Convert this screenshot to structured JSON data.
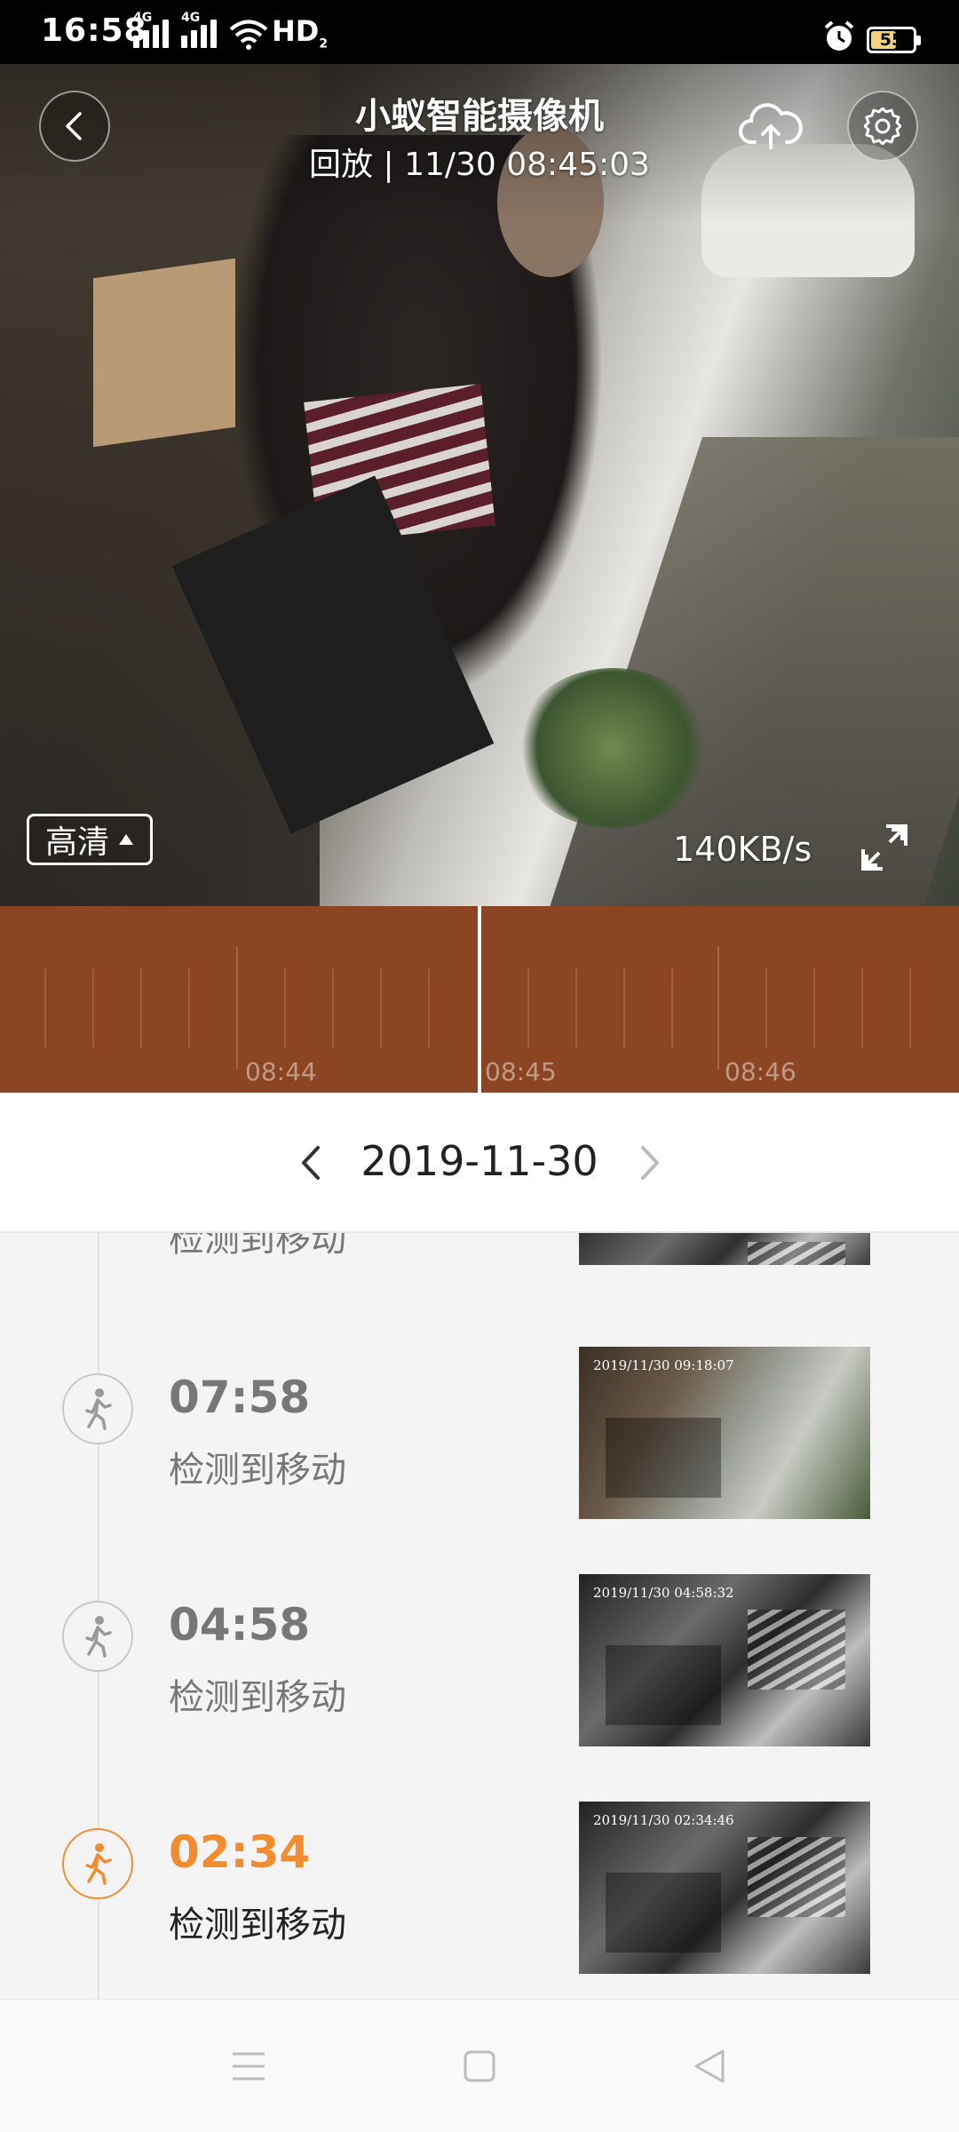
{
  "status_bar": {
    "time": "16:58",
    "signal1_tag": "4G",
    "signal2_tag": "4G",
    "hd_label": "HD",
    "hd_sub": "2",
    "battery": "55"
  },
  "header": {
    "title": "小蚁智能摄像机",
    "subtitle": "回放 | 11/30 08:45:03",
    "back_icon": "chevron-left-icon",
    "upload_icon": "cloud-upload-icon",
    "settings_icon": "gear-icon"
  },
  "player": {
    "quality_label": "高清",
    "bitrate": "140KB/s",
    "fullscreen_icon": "exit-fullscreen-icon"
  },
  "timeline": {
    "labels": [
      "08:44",
      "08:45",
      "08:46"
    ],
    "color": "#8b4523"
  },
  "date_nav": {
    "date": "2019-11-30"
  },
  "events": [
    {
      "time": "",
      "desc": "检测到移动",
      "stamp": ""
    },
    {
      "time": "07:58",
      "desc": "检测到移动",
      "stamp": "2019/11/30  09:18:07"
    },
    {
      "time": "04:58",
      "desc": "检测到移动",
      "stamp": "2019/11/30  04:58:32"
    },
    {
      "time": "02:34",
      "desc": "检测到移动",
      "stamp": "2019/11/30  02:34:46"
    }
  ],
  "colors": {
    "accent": "#f28d2f",
    "timeline_bg": "#8b4523"
  }
}
